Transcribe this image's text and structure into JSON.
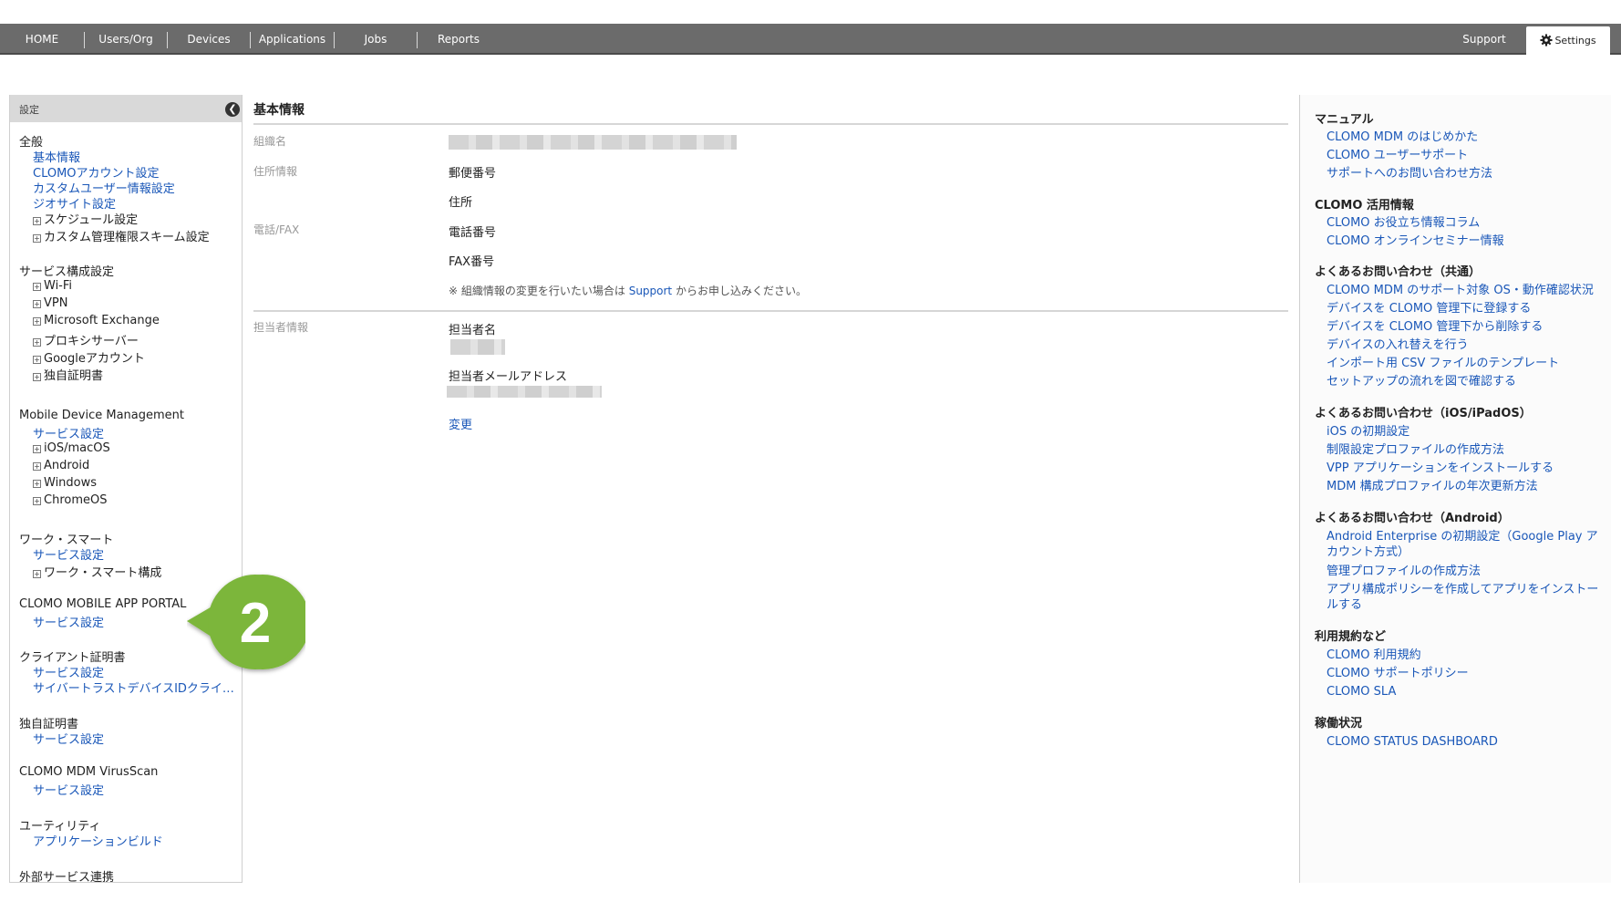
{
  "nav": {
    "items": [
      "HOME",
      "Users/Org",
      "Devices",
      "Applications",
      "Jobs",
      "Reports"
    ],
    "support": "Support",
    "settings": "Settings"
  },
  "sidebar": {
    "title": "設定",
    "sections": [
      {
        "heading": "全般",
        "items": [
          {
            "label": "基本情報",
            "type": "link"
          },
          {
            "label": "CLOMOアカウント設定",
            "type": "link"
          },
          {
            "label": "カスタムユーザー情報設定",
            "type": "link"
          },
          {
            "label": "ジオサイト設定",
            "type": "link"
          },
          {
            "label": "スケジュール設定",
            "type": "tree"
          },
          {
            "label": "カスタム管理権限スキーム設定",
            "type": "tree"
          }
        ]
      },
      {
        "heading": "サービス構成設定",
        "items": [
          {
            "label": "Wi-Fi",
            "type": "tree"
          },
          {
            "label": "VPN",
            "type": "tree"
          },
          {
            "label": "Microsoft Exchange",
            "type": "tree"
          },
          {
            "label": "プロキシサーバー",
            "type": "tree"
          },
          {
            "label": "Googleアカウント",
            "type": "tree"
          },
          {
            "label": "独自証明書",
            "type": "tree"
          }
        ]
      },
      {
        "heading": "Mobile Device Management",
        "items": [
          {
            "label": "サービス設定",
            "type": "link"
          },
          {
            "label": "iOS/macOS",
            "type": "tree"
          },
          {
            "label": "Android",
            "type": "tree"
          },
          {
            "label": "Windows",
            "type": "tree"
          },
          {
            "label": "ChromeOS",
            "type": "tree"
          }
        ]
      },
      {
        "heading": "ワーク・スマート",
        "items": [
          {
            "label": "サービス設定",
            "type": "link"
          },
          {
            "label": "ワーク・スマート構成",
            "type": "tree"
          }
        ]
      },
      {
        "heading": "CLOMO MOBILE APP PORTAL",
        "items": [
          {
            "label": "サービス設定",
            "type": "link"
          }
        ]
      },
      {
        "heading": "クライアント証明書",
        "items": [
          {
            "label": "サービス設定",
            "type": "link"
          },
          {
            "label": "サイバートラストデバイスIDクライ…",
            "type": "link"
          }
        ]
      },
      {
        "heading": "独自証明書",
        "items": [
          {
            "label": "サービス設定",
            "type": "link"
          }
        ]
      },
      {
        "heading": "CLOMO MDM VirusScan",
        "items": [
          {
            "label": "サービス設定",
            "type": "link"
          }
        ]
      },
      {
        "heading": "ユーティリティ",
        "items": [
          {
            "label": "アプリケーションビルド",
            "type": "link"
          }
        ]
      },
      {
        "heading": "外部サービス連携",
        "items": []
      }
    ]
  },
  "main": {
    "title": "基本情報",
    "org_label": "組織名",
    "address_label": "住所情報",
    "postal_code": "郵便番号",
    "address": "住所",
    "phone_label": "電話/FAX",
    "phone": "電話番号",
    "fax": "FAX番号",
    "notice_prefix": "※ 組織情報の変更を行いたい場合は",
    "notice_link": "Support",
    "notice_suffix": "からお申し込みください。",
    "contact_label": "担当者情報",
    "contact_name": "担当者名",
    "contact_email": "担当者メールアドレス",
    "change_link": "変更"
  },
  "help": {
    "sections": [
      {
        "heading": "マニュアル",
        "links": [
          "CLOMO MDM のはじめかた",
          "CLOMO ユーザーサポート",
          "サポートへのお問い合わせ方法"
        ]
      },
      {
        "heading": "CLOMO 活用情報",
        "links": [
          "CLOMO お役立ち情報コラム",
          "CLOMO オンラインセミナー情報"
        ]
      },
      {
        "heading": "よくあるお問い合わせ（共通）",
        "links": [
          "CLOMO MDM のサポート対象 OS・動作確認状況",
          "デバイスを CLOMO 管理下に登録する",
          "デバイスを CLOMO 管理下から削除する",
          "デバイスの入れ替えを行う",
          "インポート用 CSV ファイルのテンプレート",
          "セットアップの流れを図で確認する"
        ]
      },
      {
        "heading": "よくあるお問い合わせ（iOS/iPadOS）",
        "links": [
          "iOS の初期設定",
          "制限設定プロファイルの作成方法",
          "VPP アプリケーションをインストールする",
          "MDM 構成プロファイルの年次更新方法"
        ]
      },
      {
        "heading": "よくあるお問い合わせ（Android）",
        "links": [
          "Android Enterprise の初期設定（Google Play アカウント方式）",
          "管理プロファイルの作成方法",
          "アプリ構成ポリシーを作成してアプリをインストールする"
        ]
      },
      {
        "heading": "利用規約など",
        "links": [
          "CLOMO 利用規約",
          "CLOMO サポートポリシー",
          "CLOMO SLA"
        ]
      },
      {
        "heading": "稼働状況",
        "links": [
          "CLOMO STATUS DASHBOARD"
        ]
      }
    ]
  },
  "badge": {
    "number": "2",
    "color": "#7cb63a"
  }
}
